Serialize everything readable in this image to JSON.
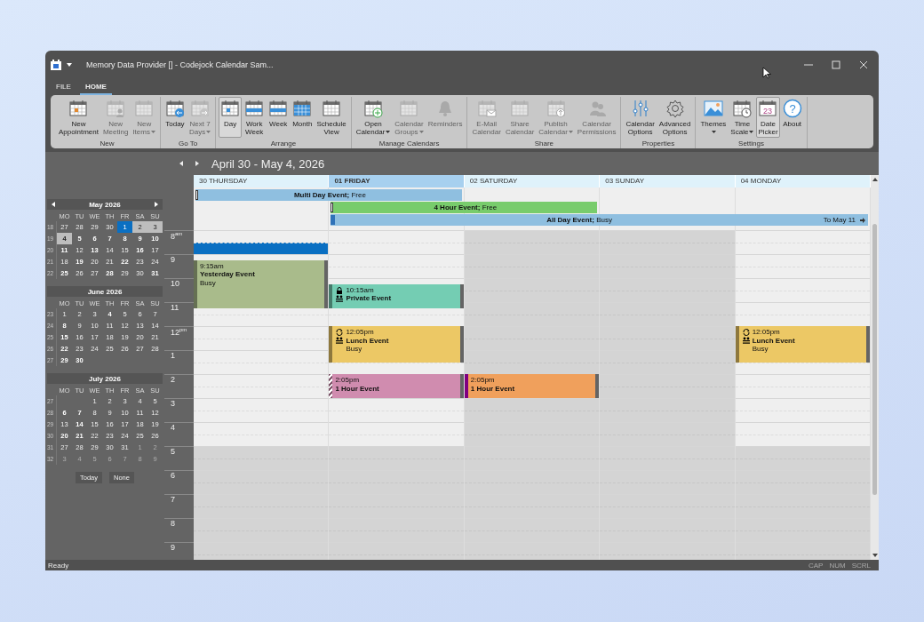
{
  "window": {
    "title": "Memory Data Provider [] - Codejock Calendar Sam..."
  },
  "ribbon_tabs": [
    {
      "label": "FILE",
      "selected": false
    },
    {
      "label": "HOME",
      "selected": true
    }
  ],
  "ribbon_groups": [
    {
      "label": "New",
      "buttons": [
        {
          "lines": [
            "New",
            "Appointment"
          ],
          "kind": "appointment",
          "disabled": false,
          "dropdown": false,
          "selected": false
        },
        {
          "lines": [
            "New",
            "Meeting"
          ],
          "kind": "meeting",
          "disabled": true,
          "dropdown": false,
          "selected": false
        },
        {
          "lines": [
            "New",
            "Items"
          ],
          "kind": "items",
          "disabled": true,
          "dropdown": true,
          "selected": false
        }
      ]
    },
    {
      "label": "Go To",
      "buttons": [
        {
          "lines": [
            "Today"
          ],
          "kind": "today",
          "disabled": false,
          "dropdown": false,
          "selected": false
        },
        {
          "lines": [
            "Next 7",
            "Days"
          ],
          "kind": "next7",
          "disabled": true,
          "dropdown": true,
          "selected": false
        }
      ]
    },
    {
      "label": "Arrange",
      "buttons": [
        {
          "lines": [
            "Day"
          ],
          "kind": "day",
          "disabled": false,
          "dropdown": false,
          "selected": true
        },
        {
          "lines": [
            "Work",
            "Week"
          ],
          "kind": "workweek",
          "disabled": false,
          "dropdown": false,
          "selected": false
        },
        {
          "lines": [
            "Week"
          ],
          "kind": "week",
          "disabled": false,
          "dropdown": false,
          "selected": false
        },
        {
          "lines": [
            "Month"
          ],
          "kind": "month",
          "disabled": false,
          "dropdown": false,
          "selected": false
        },
        {
          "lines": [
            "Schedule",
            "View"
          ],
          "kind": "schedule",
          "disabled": false,
          "dropdown": false,
          "selected": false
        }
      ]
    },
    {
      "label": "Manage Calendars",
      "buttons": [
        {
          "lines": [
            "Open",
            "Calendar"
          ],
          "kind": "open",
          "disabled": false,
          "dropdown": true,
          "selected": false
        },
        {
          "lines": [
            "Calendar",
            "Groups"
          ],
          "kind": "groups",
          "disabled": true,
          "dropdown": true,
          "selected": false
        },
        {
          "lines": [
            "Reminders"
          ],
          "kind": "bell",
          "disabled": true,
          "dropdown": false,
          "selected": false
        }
      ]
    },
    {
      "label": "Share",
      "buttons": [
        {
          "lines": [
            "E-Mail",
            "Calendar"
          ],
          "kind": "email",
          "disabled": true,
          "dropdown": false,
          "selected": false
        },
        {
          "lines": [
            "Share",
            "Calendar"
          ],
          "kind": "share",
          "disabled": true,
          "dropdown": false,
          "selected": false
        },
        {
          "lines": [
            "Publish",
            "Calendar"
          ],
          "kind": "publish",
          "disabled": true,
          "dropdown": true,
          "selected": false
        },
        {
          "lines": [
            "Calendar",
            "Permissions"
          ],
          "kind": "permissions",
          "disabled": true,
          "dropdown": false,
          "selected": false
        }
      ]
    },
    {
      "label": "Properties",
      "buttons": [
        {
          "lines": [
            "Calendar",
            "Options"
          ],
          "kind": "sliders",
          "disabled": false,
          "dropdown": false,
          "selected": false
        },
        {
          "lines": [
            "Advanced",
            "Options"
          ],
          "kind": "gear",
          "disabled": false,
          "dropdown": false,
          "selected": false
        }
      ]
    },
    {
      "label": "Settings",
      "buttons": [
        {
          "lines": [
            "Themes"
          ],
          "kind": "themes",
          "disabled": false,
          "dropdown": true,
          "selected": false
        },
        {
          "lines": [
            "Time",
            "Scale"
          ],
          "kind": "timescale",
          "disabled": false,
          "dropdown": true,
          "selected": false
        },
        {
          "lines": [
            "Date",
            "Picker"
          ],
          "kind": "datepicker",
          "icon_text": "23",
          "disabled": false,
          "dropdown": false,
          "selected": true
        },
        {
          "lines": [
            "About"
          ],
          "kind": "help",
          "icon_text": "?",
          "disabled": false,
          "dropdown": false,
          "selected": false
        }
      ]
    }
  ],
  "mini_calendars": [
    {
      "title": "May 2026",
      "nav_arrows": true,
      "weekdays": [
        "MO",
        "TU",
        "WE",
        "TH",
        "FR",
        "SA",
        "SU"
      ],
      "weeks": [
        {
          "number": "18",
          "days": [
            {
              "day": "27",
              "bold": false,
              "faded": false,
              "selected": false,
              "in_range": false
            },
            {
              "day": "28",
              "bold": false,
              "faded": false,
              "selected": false,
              "in_range": false
            },
            {
              "day": "29",
              "bold": false,
              "faded": false,
              "selected": false,
              "in_range": false
            },
            {
              "day": "30",
              "bold": false,
              "faded": false,
              "selected": false,
              "in_range": false
            },
            {
              "day": "1",
              "bold": false,
              "faded": false,
              "selected": true,
              "in_range": false
            },
            {
              "day": "2",
              "bold": false,
              "faded": false,
              "selected": false,
              "in_range": true
            },
            {
              "day": "3",
              "bold": false,
              "faded": false,
              "selected": false,
              "in_range": true
            }
          ]
        },
        {
          "number": "19",
          "days": [
            {
              "day": "4",
              "bold": true,
              "faded": false,
              "selected": false,
              "in_range": true
            },
            {
              "day": "5",
              "bold": true,
              "faded": false,
              "selected": false,
              "in_range": false
            },
            {
              "day": "6",
              "bold": true,
              "faded": false,
              "selected": false,
              "in_range": false
            },
            {
              "day": "7",
              "bold": true,
              "faded": false,
              "selected": false,
              "in_range": false
            },
            {
              "day": "8",
              "bold": true,
              "faded": false,
              "selected": false,
              "in_range": false
            },
            {
              "day": "9",
              "bold": true,
              "faded": false,
              "selected": false,
              "in_range": false
            },
            {
              "day": "10",
              "bold": true,
              "faded": false,
              "selected": false,
              "in_range": false
            }
          ]
        },
        {
          "number": "20",
          "days": [
            {
              "day": "11",
              "bold": true,
              "faded": false,
              "selected": false,
              "in_range": false
            },
            {
              "day": "12",
              "bold": false,
              "faded": false,
              "selected": false,
              "in_range": false
            },
            {
              "day": "13",
              "bold": true,
              "faded": false,
              "selected": false,
              "in_range": false
            },
            {
              "day": "14",
              "bold": false,
              "faded": false,
              "selected": false,
              "in_range": false
            },
            {
              "day": "15",
              "bold": false,
              "faded": false,
              "selected": false,
              "in_range": false
            },
            {
              "day": "16",
              "bold": true,
              "faded": false,
              "selected": false,
              "in_range": false
            },
            {
              "day": "17",
              "bold": false,
              "faded": false,
              "selected": false,
              "in_range": false
            }
          ]
        },
        {
          "number": "21",
          "days": [
            {
              "day": "18",
              "bold": false,
              "faded": false,
              "selected": false,
              "in_range": false
            },
            {
              "day": "19",
              "bold": true,
              "faded": false,
              "selected": false,
              "in_range": false
            },
            {
              "day": "20",
              "bold": false,
              "faded": false,
              "selected": false,
              "in_range": false
            },
            {
              "day": "21",
              "bold": false,
              "faded": false,
              "selected": false,
              "in_range": false
            },
            {
              "day": "22",
              "bold": true,
              "faded": false,
              "selected": false,
              "in_range": false
            },
            {
              "day": "23",
              "bold": false,
              "faded": false,
              "selected": false,
              "in_range": false
            },
            {
              "day": "24",
              "bold": false,
              "faded": false,
              "selected": false,
              "in_range": false
            }
          ]
        },
        {
          "number": "22",
          "days": [
            {
              "day": "25",
              "bold": true,
              "faded": false,
              "selected": false,
              "in_range": false
            },
            {
              "day": "26",
              "bold": false,
              "faded": false,
              "selected": false,
              "in_range": false
            },
            {
              "day": "27",
              "bold": false,
              "faded": false,
              "selected": false,
              "in_range": false
            },
            {
              "day": "28",
              "bold": true,
              "faded": false,
              "selected": false,
              "in_range": false
            },
            {
              "day": "29",
              "bold": false,
              "faded": false,
              "selected": false,
              "in_range": false
            },
            {
              "day": "30",
              "bold": false,
              "faded": false,
              "selected": false,
              "in_range": false
            },
            {
              "day": "31",
              "bold": true,
              "faded": false,
              "selected": false,
              "in_range": false
            }
          ]
        }
      ]
    },
    {
      "title": "June 2026",
      "nav_arrows": false,
      "weekdays": [
        "MO",
        "TU",
        "WE",
        "TH",
        "FR",
        "SA",
        "SU"
      ],
      "weeks": [
        {
          "number": "23",
          "days": [
            {
              "day": "1",
              "bold": false,
              "faded": false,
              "selected": false,
              "in_range": false
            },
            {
              "day": "2",
              "bold": false,
              "faded": false,
              "selected": false,
              "in_range": false
            },
            {
              "day": "3",
              "bold": false,
              "faded": false,
              "selected": false,
              "in_range": false
            },
            {
              "day": "4",
              "bold": true,
              "faded": false,
              "selected": false,
              "in_range": false
            },
            {
              "day": "5",
              "bold": false,
              "faded": false,
              "selected": false,
              "in_range": false
            },
            {
              "day": "6",
              "bold": false,
              "faded": false,
              "selected": false,
              "in_range": false
            },
            {
              "day": "7",
              "bold": false,
              "faded": false,
              "selected": false,
              "in_range": false
            }
          ]
        },
        {
          "number": "24",
          "days": [
            {
              "day": "8",
              "bold": true,
              "faded": false,
              "selected": false,
              "in_range": false
            },
            {
              "day": "9",
              "bold": false,
              "faded": false,
              "selected": false,
              "in_range": false
            },
            {
              "day": "10",
              "bold": false,
              "faded": false,
              "selected": false,
              "in_range": false
            },
            {
              "day": "11",
              "bold": false,
              "faded": false,
              "selected": false,
              "in_range": false
            },
            {
              "day": "12",
              "bold": false,
              "faded": false,
              "selected": false,
              "in_range": false
            },
            {
              "day": "13",
              "bold": false,
              "faded": false,
              "selected": false,
              "in_range": false
            },
            {
              "day": "14",
              "bold": false,
              "faded": false,
              "selected": false,
              "in_range": false
            }
          ]
        },
        {
          "number": "25",
          "days": [
            {
              "day": "15",
              "bold": true,
              "faded": false,
              "selected": false,
              "in_range": false
            },
            {
              "day": "16",
              "bold": false,
              "faded": false,
              "selected": false,
              "in_range": false
            },
            {
              "day": "17",
              "bold": false,
              "faded": false,
              "selected": false,
              "in_range": false
            },
            {
              "day": "18",
              "bold": false,
              "faded": false,
              "selected": false,
              "in_range": false
            },
            {
              "day": "19",
              "bold": false,
              "faded": false,
              "selected": false,
              "in_range": false
            },
            {
              "day": "20",
              "bold": false,
              "faded": false,
              "selected": false,
              "in_range": false
            },
            {
              "day": "21",
              "bold": false,
              "faded": false,
              "selected": false,
              "in_range": false
            }
          ]
        },
        {
          "number": "26",
          "days": [
            {
              "day": "22",
              "bold": true,
              "faded": false,
              "selected": false,
              "in_range": false
            },
            {
              "day": "23",
              "bold": false,
              "faded": false,
              "selected": false,
              "in_range": false
            },
            {
              "day": "24",
              "bold": false,
              "faded": false,
              "selected": false,
              "in_range": false
            },
            {
              "day": "25",
              "bold": false,
              "faded": false,
              "selected": false,
              "in_range": false
            },
            {
              "day": "26",
              "bold": false,
              "faded": false,
              "selected": false,
              "in_range": false
            },
            {
              "day": "27",
              "bold": false,
              "faded": false,
              "selected": false,
              "in_range": false
            },
            {
              "day": "28",
              "bold": false,
              "faded": false,
              "selected": false,
              "in_range": false
            }
          ]
        },
        {
          "number": "27",
          "days": [
            {
              "day": "29",
              "bold": true,
              "faded": false,
              "selected": false,
              "in_range": false
            },
            {
              "day": "30",
              "bold": true,
              "faded": false,
              "selected": false,
              "in_range": false
            }
          ]
        }
      ]
    },
    {
      "title": "July 2026",
      "nav_arrows": false,
      "weekdays": [
        "MO",
        "TU",
        "WE",
        "TH",
        "FR",
        "SA",
        "SU"
      ],
      "weeks": [
        {
          "number": "27",
          "days": [
            {
              "day": "1",
              "bold": false,
              "faded": false,
              "selected": false,
              "in_range": false
            },
            {
              "day": "2",
              "bold": false,
              "faded": false,
              "selected": false,
              "in_range": false
            },
            {
              "day": "3",
              "bold": false,
              "faded": false,
              "selected": false,
              "in_range": false
            },
            {
              "day": "4",
              "bold": false,
              "faded": false,
              "selected": false,
              "in_range": false
            },
            {
              "day": "5",
              "bold": false,
              "faded": false,
              "selected": false,
              "in_range": false
            }
          ]
        },
        {
          "number": "28",
          "days": [
            {
              "day": "6",
              "bold": true,
              "faded": false,
              "selected": false,
              "in_range": false
            },
            {
              "day": "7",
              "bold": true,
              "faded": false,
              "selected": false,
              "in_range": false
            },
            {
              "day": "8",
              "bold": false,
              "faded": false,
              "selected": false,
              "in_range": false
            },
            {
              "day": "9",
              "bold": false,
              "faded": false,
              "selected": false,
              "in_range": false
            },
            {
              "day": "10",
              "bold": false,
              "faded": false,
              "selected": false,
              "in_range": false
            },
            {
              "day": "11",
              "bold": false,
              "faded": false,
              "selected": false,
              "in_range": false
            },
            {
              "day": "12",
              "bold": false,
              "faded": false,
              "selected": false,
              "in_range": false
            }
          ]
        },
        {
          "number": "29",
          "days": [
            {
              "day": "13",
              "bold": false,
              "faded": false,
              "selected": false,
              "in_range": false
            },
            {
              "day": "14",
              "bold": true,
              "faded": false,
              "selected": false,
              "in_range": false
            },
            {
              "day": "15",
              "bold": false,
              "faded": false,
              "selected": false,
              "in_range": false
            },
            {
              "day": "16",
              "bold": false,
              "faded": false,
              "selected": false,
              "in_range": false
            },
            {
              "day": "17",
              "bold": false,
              "faded": false,
              "selected": false,
              "in_range": false
            },
            {
              "day": "18",
              "bold": false,
              "faded": false,
              "selected": false,
              "in_range": false
            },
            {
              "day": "19",
              "bold": false,
              "faded": false,
              "selected": false,
              "in_range": false
            }
          ]
        },
        {
          "number": "30",
          "days": [
            {
              "day": "20",
              "bold": true,
              "faded": false,
              "selected": false,
              "in_range": false
            },
            {
              "day": "21",
              "bold": true,
              "faded": false,
              "selected": false,
              "in_range": false
            },
            {
              "day": "22",
              "bold": false,
              "faded": false,
              "selected": false,
              "in_range": false
            },
            {
              "day": "23",
              "bold": false,
              "faded": false,
              "selected": false,
              "in_range": false
            },
            {
              "day": "24",
              "bold": false,
              "faded": false,
              "selected": false,
              "in_range": false
            },
            {
              "day": "25",
              "bold": false,
              "faded": false,
              "selected": false,
              "in_range": false
            },
            {
              "day": "26",
              "bold": false,
              "faded": false,
              "selected": false,
              "in_range": false
            }
          ]
        },
        {
          "number": "31",
          "days": [
            {
              "day": "27",
              "bold": false,
              "faded": false,
              "selected": false,
              "in_range": false
            },
            {
              "day": "28",
              "bold": false,
              "faded": false,
              "selected": false,
              "in_range": false
            },
            {
              "day": "29",
              "bold": false,
              "faded": false,
              "selected": false,
              "in_range": false
            },
            {
              "day": "30",
              "bold": false,
              "faded": false,
              "selected": false,
              "in_range": false
            },
            {
              "day": "31",
              "bold": false,
              "faded": false,
              "selected": false,
              "in_range": false
            },
            {
              "day": "1",
              "bold": false,
              "faded": true,
              "selected": false,
              "in_range": false
            },
            {
              "day": "2",
              "bold": false,
              "faded": true,
              "selected": false,
              "in_range": false
            }
          ]
        },
        {
          "number": "32",
          "days": [
            {
              "day": "3",
              "bold": false,
              "faded": true,
              "selected": false,
              "in_range": false
            },
            {
              "day": "4",
              "bold": false,
              "faded": true,
              "selected": false,
              "in_range": false
            },
            {
              "day": "5",
              "bold": false,
              "faded": true,
              "selected": false,
              "in_range": false
            },
            {
              "day": "6",
              "bold": false,
              "faded": true,
              "selected": false,
              "in_range": false
            },
            {
              "day": "7",
              "bold": false,
              "faded": true,
              "selected": false,
              "in_range": false
            },
            {
              "day": "8",
              "bold": false,
              "faded": true,
              "selected": false,
              "in_range": false
            },
            {
              "day": "9",
              "bold": false,
              "faded": true,
              "selected": false,
              "in_range": false
            }
          ]
        }
      ]
    }
  ],
  "mini_calendar_buttons": [
    "Today",
    "None"
  ],
  "calendar": {
    "title": "April 30 - May 4, 2026",
    "days": [
      {
        "label": "30 THURSDAY",
        "selected": false,
        "workday": true,
        "all_day_events": [
          {
            "text": "**Multi Day Event;** Free",
            "kind": "two_days",
            "busy": false,
            "color": "#8fbfe0"
          }
        ],
        "selected_half_hours": [
          false,
          true
        ],
        "events": [
          {
            "time": "9:15am",
            "title": "Yesterday Event",
            "status": "Busy",
            "kind": "two_hours",
            "color": "#a9bb8b",
            "tentative": false,
            "out_of_office": false
          }
        ]
      },
      {
        "label": "01 FRIDAY",
        "selected": true,
        "workday": true,
        "all_day_events": [
          {
            "text": "**4 Hour Event;** Free",
            "kind": "two_days",
            "busy": false,
            "color": "#78cc6c"
          },
          {
            "text": "**All Day Event;** Busy",
            "kind": "four_days",
            "busy": true,
            "color": "#8fbfe0",
            "continues": "To May 11"
          }
        ],
        "events": [
          {
            "time": "10:15am",
            "title": "Private Event",
            "kind": "one_hour",
            "color": "#74cdb3",
            "tentative": false,
            "out_of_office": false,
            "icons": [
              {
                "kind": "lock"
              },
              {
                "kind": "people"
              }
            ]
          },
          {
            "time": "12:05pm",
            "title": "Lunch Event",
            "status": "Busy",
            "kind": "ninety_minutes",
            "color": "#ecc865",
            "tentative": false,
            "out_of_office": false,
            "icons": [
              {
                "kind": "recurrence"
              },
              {
                "kind": "people"
              }
            ]
          },
          {
            "time": "2:05pm",
            "title": "1 Hour Event",
            "kind": "one_hour",
            "color": "#d08caf",
            "tentative": true,
            "out_of_office": false
          }
        ]
      },
      {
        "label": "02 SATURDAY",
        "selected": false,
        "workday": false,
        "events": [
          {
            "time": "2:05pm",
            "title": "1 Hour Event",
            "kind": "one_hour",
            "color": "#f0a05c",
            "tentative": false,
            "out_of_office": true
          }
        ]
      },
      {
        "label": "03 SUNDAY",
        "selected": false,
        "workday": false
      },
      {
        "label": "04 MONDAY",
        "selected": false,
        "workday": true,
        "events": [
          {
            "time": "12:05pm",
            "title": "Lunch Event",
            "status": "Busy",
            "kind": "ninety_minutes",
            "color": "#ecc865",
            "tentative": false,
            "out_of_office": false,
            "icons": [
              {
                "kind": "recurrence"
              },
              {
                "kind": "people"
              }
            ]
          }
        ]
      }
    ],
    "hours": [
      {
        "hour": "8",
        "suffix": "am",
        "work": true
      },
      {
        "hour": "9",
        "work": true
      },
      {
        "hour": "10",
        "work": true
      },
      {
        "hour": "11",
        "work": true
      },
      {
        "hour": "12",
        "suffix": "pm",
        "work": true
      },
      {
        "hour": "1",
        "work": true
      },
      {
        "hour": "2",
        "work": true
      },
      {
        "hour": "3",
        "work": true
      },
      {
        "hour": "4",
        "work": true
      },
      {
        "hour": "5",
        "work": false
      },
      {
        "hour": "6",
        "work": false
      },
      {
        "hour": "7",
        "work": false
      },
      {
        "hour": "8",
        "work": false
      },
      {
        "hour": "9",
        "work": false
      }
    ]
  },
  "status_bar": {
    "text": "Ready",
    "indicators": [
      {
        "label": "CAP",
        "on": false
      },
      {
        "label": "NUM",
        "on": false
      },
      {
        "label": "SCRL",
        "on": false
      }
    ]
  }
}
